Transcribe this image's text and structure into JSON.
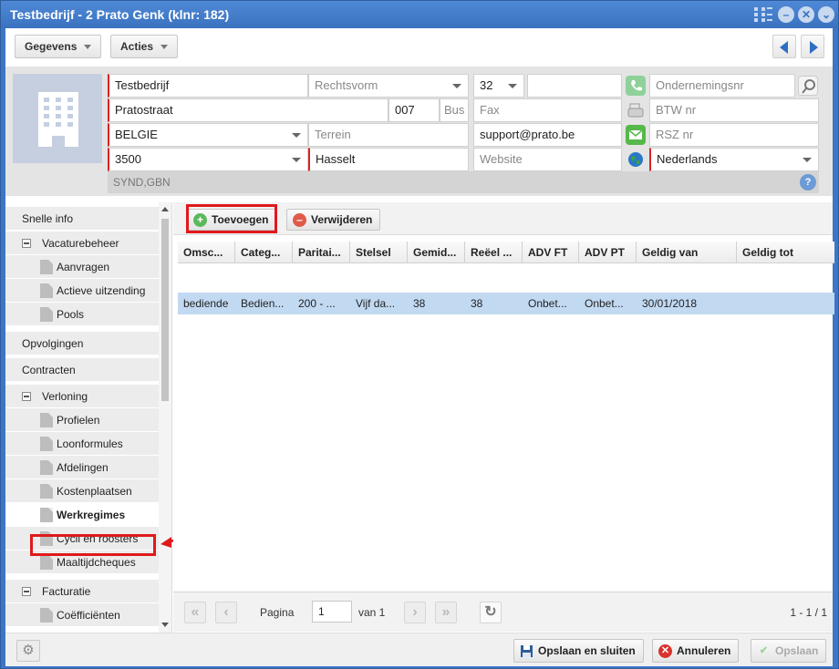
{
  "window": {
    "title": "Testbedrijf - 2 Prato Genk (klnr: 182)"
  },
  "toolbar": {
    "gegevens_label": "Gegevens",
    "acties_label": "Acties"
  },
  "header": {
    "name": "Testbedrijf",
    "rechtsvorm_placeholder": "Rechtsvorm",
    "phone_prefix": "32",
    "phone": "",
    "ondernemingsnr_placeholder": "Ondernemingsnr",
    "street": "Pratostraat",
    "number": "007",
    "bus_placeholder": "Bus",
    "fax_placeholder": "Fax",
    "btw_placeholder": "BTW nr",
    "country": "BELGIE",
    "terrein_placeholder": "Terrein",
    "email": "support@prato.be",
    "rsz_placeholder": "RSZ nr",
    "postcode": "3500",
    "city": "Hasselt",
    "website_placeholder": "Website",
    "language": "Nederlands",
    "tags": "SYND,GBN"
  },
  "nav": {
    "snelle_info": "Snelle info",
    "vacaturebeheer": "Vacaturebeheer",
    "aanvragen": "Aanvragen",
    "actieve_uitzending": "Actieve uitzending",
    "pools": "Pools",
    "opvolgingen": "Opvolgingen",
    "contracten": "Contracten",
    "verloning": "Verloning",
    "profielen": "Profielen",
    "loonformules": "Loonformules",
    "afdelingen": "Afdelingen",
    "kostenplaatsen": "Kostenplaatsen",
    "werkregimes": "Werkregimes",
    "cycli": "Cycli en roosters",
    "maaltijdcheques": "Maaltijdcheques",
    "facturatie": "Facturatie",
    "coefficienten": "Coëfficiënten"
  },
  "grid": {
    "add_label": "Toevoegen",
    "remove_label": "Verwijderen",
    "columns": [
      "Omsc...",
      "Categ...",
      "Paritai...",
      "Stelsel",
      "Gemid...",
      "Reëel ...",
      "ADV FT",
      "ADV PT",
      "Geldig van",
      "Geldig tot"
    ],
    "row": [
      "bediende",
      "Bedien...",
      "200 - ...",
      "Vijf da...",
      "38",
      "38",
      "Onbet...",
      "Onbet...",
      "30/01/2018",
      ""
    ]
  },
  "pager": {
    "pagina_label": "Pagina",
    "page_value": "1",
    "van_label": "van 1",
    "total": "1 - 1 / 1"
  },
  "footer": {
    "save_close_label": "Opslaan en sluiten",
    "cancel_label": "Annuleren",
    "save_label": "Opslaan"
  }
}
